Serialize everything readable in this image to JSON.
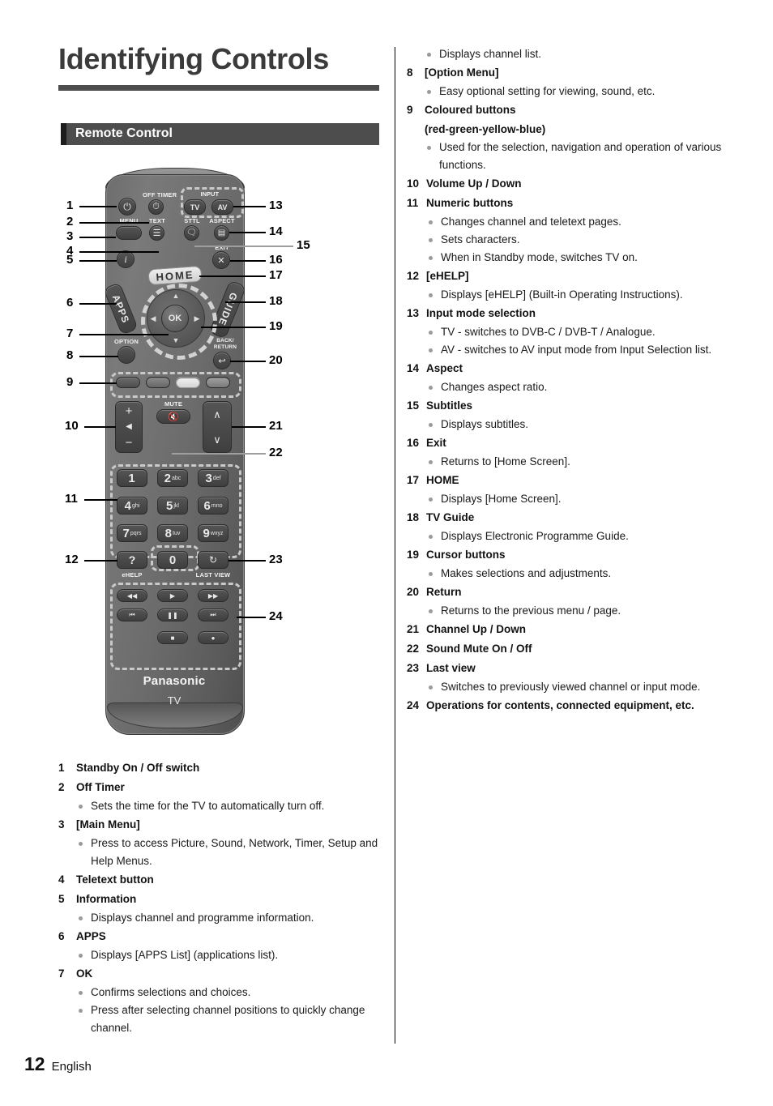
{
  "page": {
    "title": "Identifying Controls",
    "section_title": "Remote Control",
    "footer_page_number": "12",
    "footer_language": "English"
  },
  "remote": {
    "brand": "Panasonic",
    "device_label": "TV",
    "labels": {
      "off_timer": "OFF TIMER",
      "input": "INPUT",
      "tv": "TV",
      "av": "AV",
      "menu": "MENU",
      "text": "TEXT",
      "sttl": "STTL",
      "aspect": "ASPECT",
      "exit": "EXIT",
      "home": "HOME",
      "guide": "GUIDE",
      "apps": "APPS",
      "option": "OPTION",
      "ok": "OK",
      "back_return_line1": "BACK/",
      "back_return_line2": "RETURN",
      "mute": "MUTE",
      "ehelp": "eHELP",
      "last_view": "LAST VIEW"
    },
    "numeric_keys": [
      {
        "digit": "1",
        "letters": ""
      },
      {
        "digit": "2",
        "letters": "abc"
      },
      {
        "digit": "3",
        "letters": "def"
      },
      {
        "digit": "4",
        "letters": "ghi"
      },
      {
        "digit": "5",
        "letters": "jkl"
      },
      {
        "digit": "6",
        "letters": "mno"
      },
      {
        "digit": "7",
        "letters": "pqrs"
      },
      {
        "digit": "8",
        "letters": "tuv"
      },
      {
        "digit": "9",
        "letters": "wxyz"
      },
      {
        "digit": "0",
        "letters": ""
      }
    ],
    "coloured_buttons": [
      "red",
      "green",
      "yellow",
      "blue"
    ],
    "callouts_left": [
      "1",
      "2",
      "3",
      "4",
      "5",
      "6",
      "7",
      "8",
      "9",
      "10",
      "11",
      "12"
    ],
    "callouts_right": [
      "13",
      "14",
      "15",
      "16",
      "17",
      "18",
      "19",
      "20",
      "21",
      "22",
      "23",
      "24"
    ]
  },
  "left_column": [
    {
      "num": "1",
      "title": "Standby On / Off switch",
      "bullets": []
    },
    {
      "num": "2",
      "title": "Off Timer",
      "bullets": [
        "Sets the time for the TV to automatically turn off."
      ]
    },
    {
      "num": "3",
      "title": "[Main Menu]",
      "bullets": [
        "Press to access Picture, Sound, Network, Timer, Setup and Help Menus."
      ]
    },
    {
      "num": "4",
      "title": "Teletext button",
      "bullets": []
    },
    {
      "num": "5",
      "title": "Information",
      "bullets": [
        "Displays channel and programme information."
      ]
    },
    {
      "num": "6",
      "title": "APPS",
      "bullets": [
        "Displays [APPS List] (applications list)."
      ]
    },
    {
      "num": "7",
      "title": "OK",
      "bullets": [
        "Confirms selections and choices.",
        "Press after selecting channel positions to quickly change channel."
      ]
    }
  ],
  "right_column_lead_bullet": "Displays channel list.",
  "right_column": [
    {
      "num": "8",
      "title": "[Option Menu]",
      "subtitle": "",
      "bullets": [
        "Easy optional setting for viewing, sound, etc."
      ]
    },
    {
      "num": "9",
      "title": "Coloured buttons",
      "subtitle": "(red-green-yellow-blue)",
      "bullets": [
        "Used for the selection, navigation and operation of various functions."
      ]
    },
    {
      "num": "10",
      "title": "Volume Up / Down",
      "subtitle": "",
      "bullets": []
    },
    {
      "num": "11",
      "title": "Numeric buttons",
      "subtitle": "",
      "bullets": [
        "Changes channel and teletext pages.",
        "Sets characters.",
        "When in Standby mode, switches TV on."
      ]
    },
    {
      "num": "12",
      "title": "[eHELP]",
      "subtitle": "",
      "bullets": [
        "Displays [eHELP] (Built-in Operating Instructions)."
      ]
    },
    {
      "num": "13",
      "title": "Input mode selection",
      "subtitle": "",
      "bullets": [
        "TV - switches to DVB-C / DVB-T / Analogue.",
        "AV - switches to AV input mode from Input Selection list."
      ]
    },
    {
      "num": "14",
      "title": "Aspect",
      "subtitle": "",
      "bullets": [
        "Changes aspect ratio."
      ]
    },
    {
      "num": "15",
      "title": "Subtitles",
      "subtitle": "",
      "bullets": [
        "Displays subtitles."
      ]
    },
    {
      "num": "16",
      "title": "Exit",
      "subtitle": "",
      "bullets": [
        "Returns to [Home Screen]."
      ]
    },
    {
      "num": "17",
      "title": "HOME",
      "subtitle": "",
      "bullets": [
        "Displays [Home Screen]."
      ]
    },
    {
      "num": "18",
      "title": "TV Guide",
      "subtitle": "",
      "bullets": [
        "Displays Electronic Programme Guide."
      ]
    },
    {
      "num": "19",
      "title": "Cursor buttons",
      "subtitle": "",
      "bullets": [
        "Makes selections and adjustments."
      ]
    },
    {
      "num": "20",
      "title": "Return",
      "subtitle": "",
      "bullets": [
        "Returns to the previous menu / page."
      ]
    },
    {
      "num": "21",
      "title": "Channel Up / Down",
      "subtitle": "",
      "bullets": []
    },
    {
      "num": "22",
      "title": "Sound Mute On / Off",
      "subtitle": "",
      "bullets": []
    },
    {
      "num": "23",
      "title": "Last view",
      "subtitle": "",
      "bullets": [
        "Switches to previously viewed channel or input mode."
      ]
    },
    {
      "num": "24",
      "title": "Operations for contents, connected equipment, etc.",
      "subtitle": "",
      "bullets": []
    }
  ],
  "colors": {
    "header_bar": "#4d4d4d",
    "title_text": "#3b3b3b",
    "remote_body": "#6b6b6b",
    "bullet_dot": "#9a9a9a",
    "coloured_red": "#595959",
    "coloured_green": "#6a6a6a",
    "coloured_yellow": "#d8d8d8",
    "coloured_blue": "#8a8a8a"
  }
}
